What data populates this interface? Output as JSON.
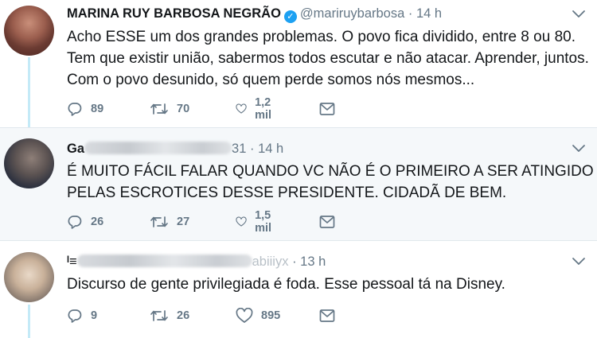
{
  "tweets": [
    {
      "name": "MARINA RUY BARBOSA NEGRÃO",
      "verified": "✓",
      "handle": "@mariruybarbosa",
      "separator": "·",
      "time": "14 h",
      "text_lines": [
        "Acho ESSE um dos grandes problemas. O povo fica dividido, entre 8 ou 80.",
        "Tem que existir união, sabermos todos escutar e não atacar. Aprender, juntos.",
        "Com o povo desunido, só quem perde somos nós mesmos..."
      ],
      "replies": "89",
      "retweets": "70",
      "likes": "1,2 mil"
    },
    {
      "name_partial": "Ga",
      "handle_partial": "31",
      "separator": "·",
      "time": "14 h",
      "text_lines": [
        "É MUITO FÁCIL FALAR QUANDO VC NÃO É O PRIMEIRO A SER ATINGIDO",
        "PELAS ESCROTICES DESSE PRESIDENTE.  CIDADÃ DE BEM."
      ],
      "replies": "26",
      "retweets": "27",
      "likes": "1,5 mil"
    },
    {
      "name_partial": "ᴵ≡",
      "handle_partial": "abiiiyx",
      "separator": "·",
      "time": "13 h",
      "text_lines": [
        "Discurso de gente privilegiada é foda. Esse pessoal tá na Disney."
      ],
      "replies": "9",
      "retweets": "26",
      "likes": "895"
    }
  ],
  "colors": {
    "verified": "#1da1f2",
    "thread_line": "#c4eaf7",
    "secondary_text": "#657786",
    "reply_background": "#f5f8fa"
  },
  "icons": [
    "reply-icon",
    "retweet-icon",
    "like-icon",
    "direct-message-icon",
    "caret-down-icon",
    "verified-badge-icon"
  ]
}
